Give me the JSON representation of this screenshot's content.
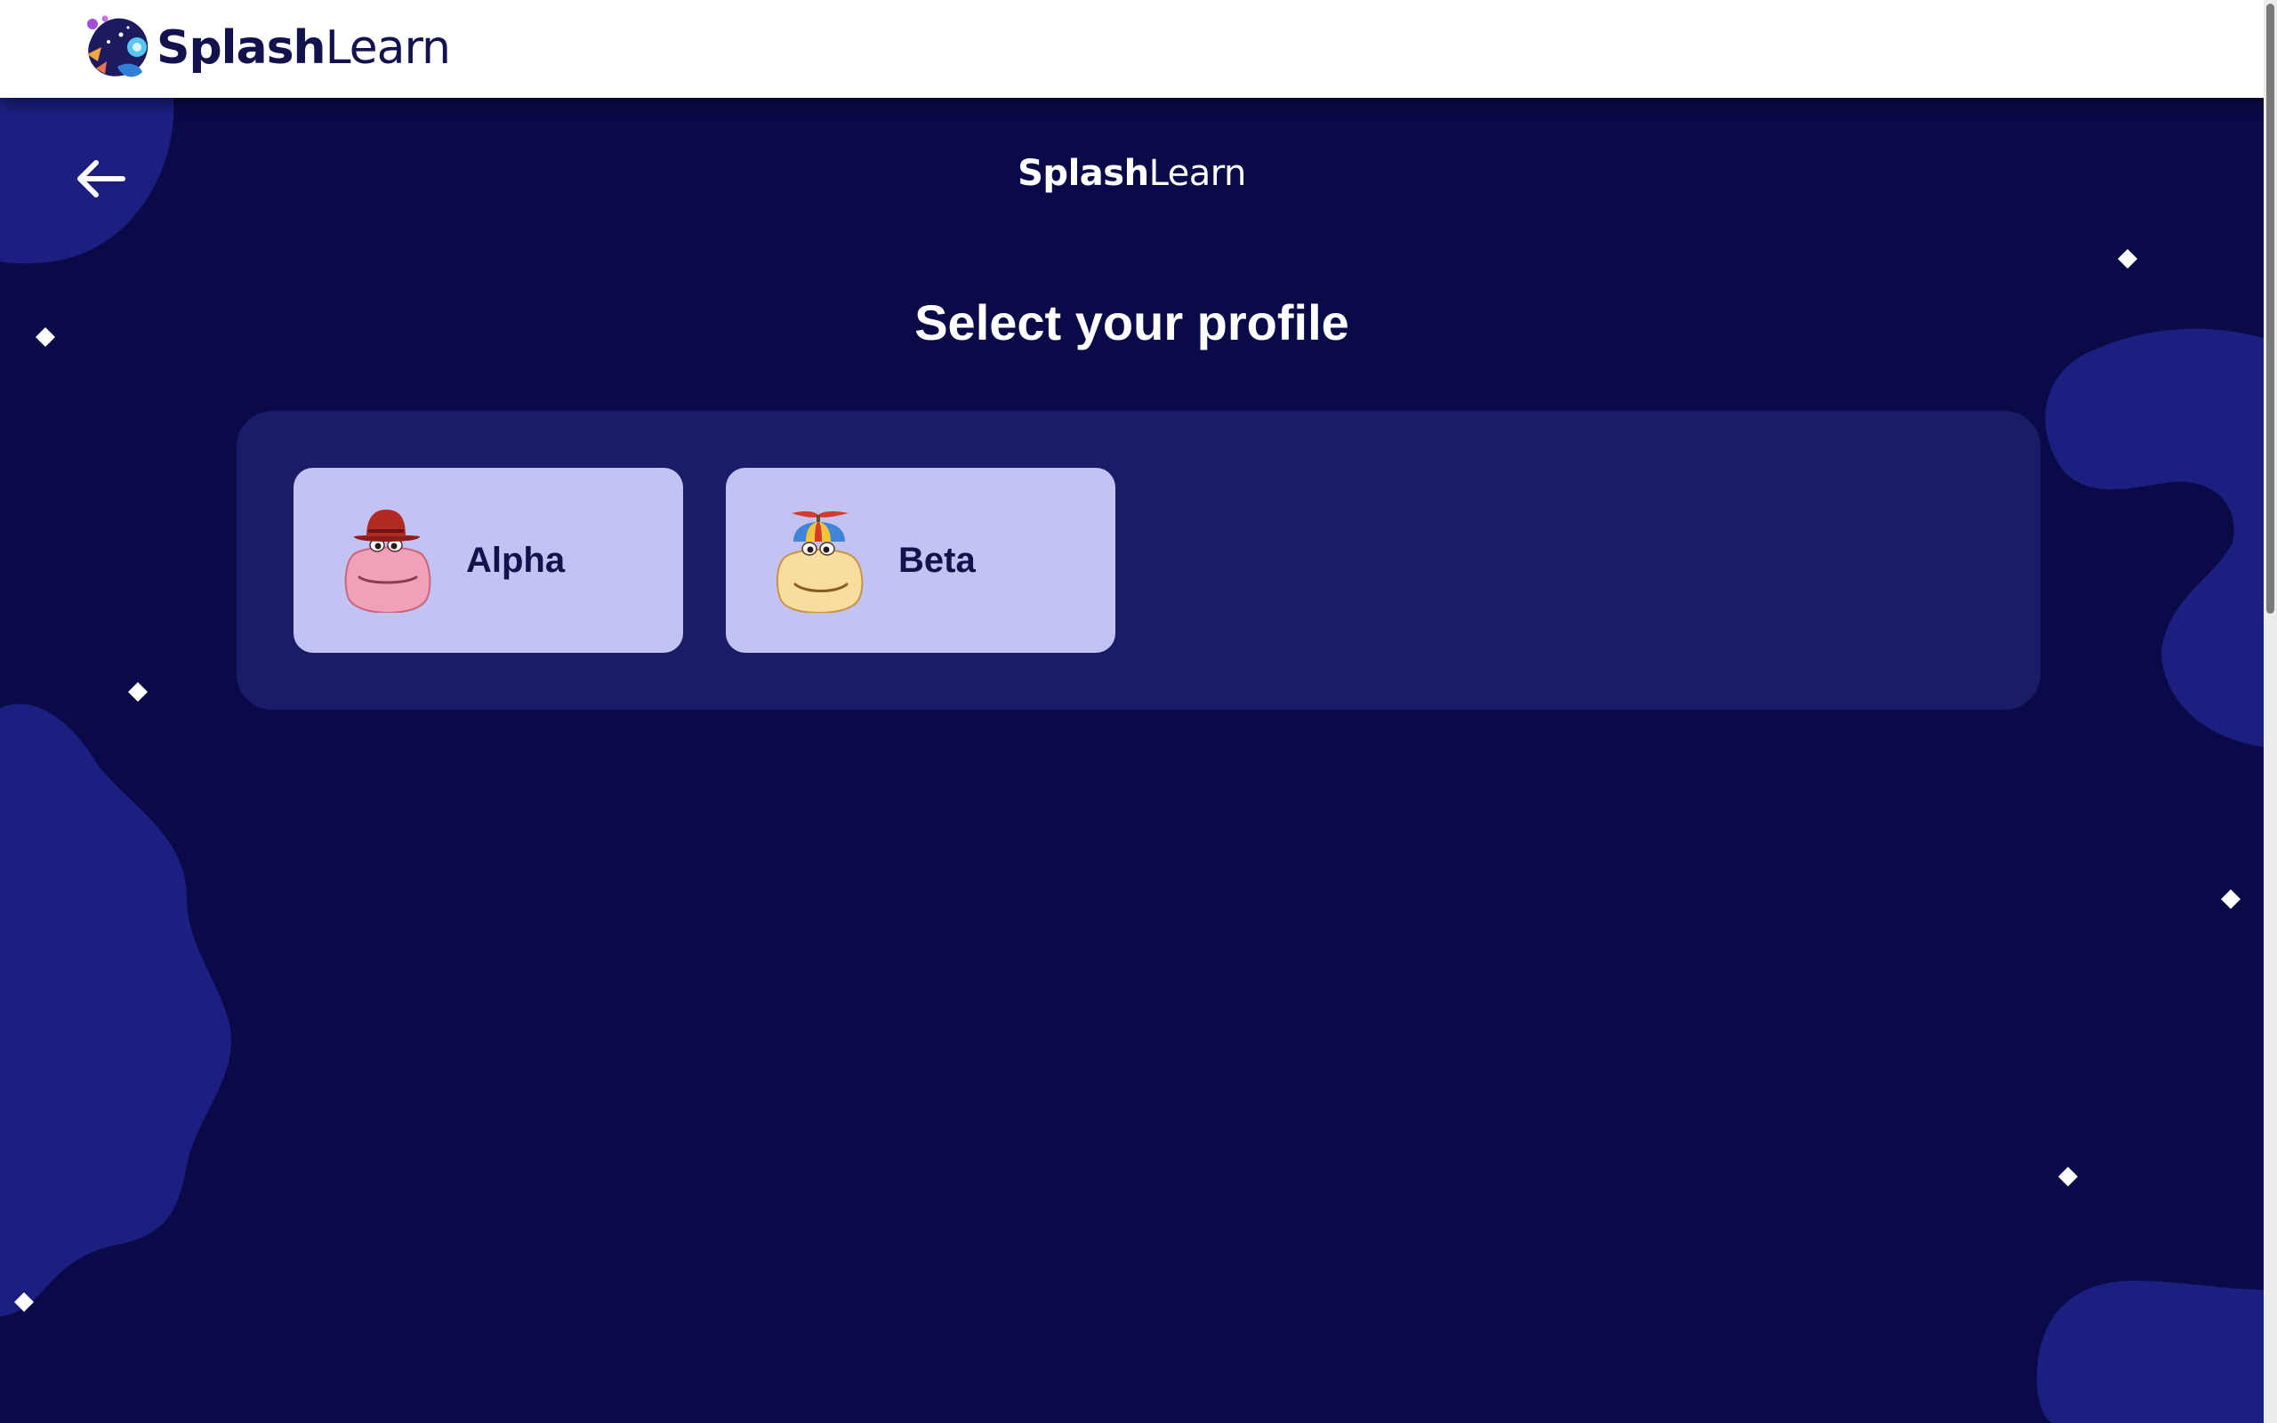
{
  "header": {
    "brand_bold": "Splash",
    "brand_light": "Learn"
  },
  "stage": {
    "brand_bold": "Splash",
    "brand_light": "Learn",
    "title": "Select your profile",
    "back_icon": "arrow-left-icon"
  },
  "profiles": [
    {
      "name": "Alpha",
      "avatar": "pink-hippo-with-hat-icon"
    },
    {
      "name": "Beta",
      "avatar": "yellow-hippo-with-propeller-cap-icon"
    }
  ],
  "colors": {
    "background": "#0b0a48",
    "panel": "#1b1c68",
    "card": "#c2c3f3",
    "text_dark": "#14124c",
    "blob": "#1a1f80"
  }
}
